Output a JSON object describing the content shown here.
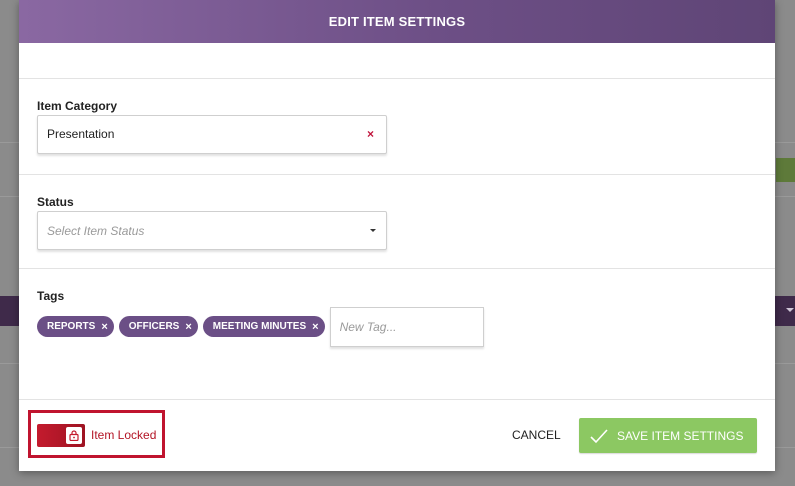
{
  "modal": {
    "title": "EDIT ITEM SETTINGS"
  },
  "category": {
    "label": "Item Category",
    "value": "Presentation",
    "clear_glyph": "×"
  },
  "status": {
    "label": "Status",
    "placeholder": "Select Item Status"
  },
  "tags": {
    "label": "Tags",
    "items": [
      {
        "label": "REPORTS",
        "remove": "×"
      },
      {
        "label": "OFFICERS",
        "remove": "×"
      },
      {
        "label": "MEETING MINUTES",
        "remove": "×"
      }
    ],
    "new_tag_placeholder": "New Tag..."
  },
  "footer": {
    "lock_label": "Item Locked",
    "lock_state": "locked",
    "lock_icon": "lock-icon",
    "cancel_label": "CANCEL",
    "save_label": "SAVE ITEM SETTINGS",
    "save_icon": "check-icon"
  },
  "colors": {
    "header": "#7a5c94",
    "tag": "#6b4f86",
    "lock_toggle": "#c41b2e",
    "save_button": "#8cc862",
    "highlight": "#c0142f"
  }
}
